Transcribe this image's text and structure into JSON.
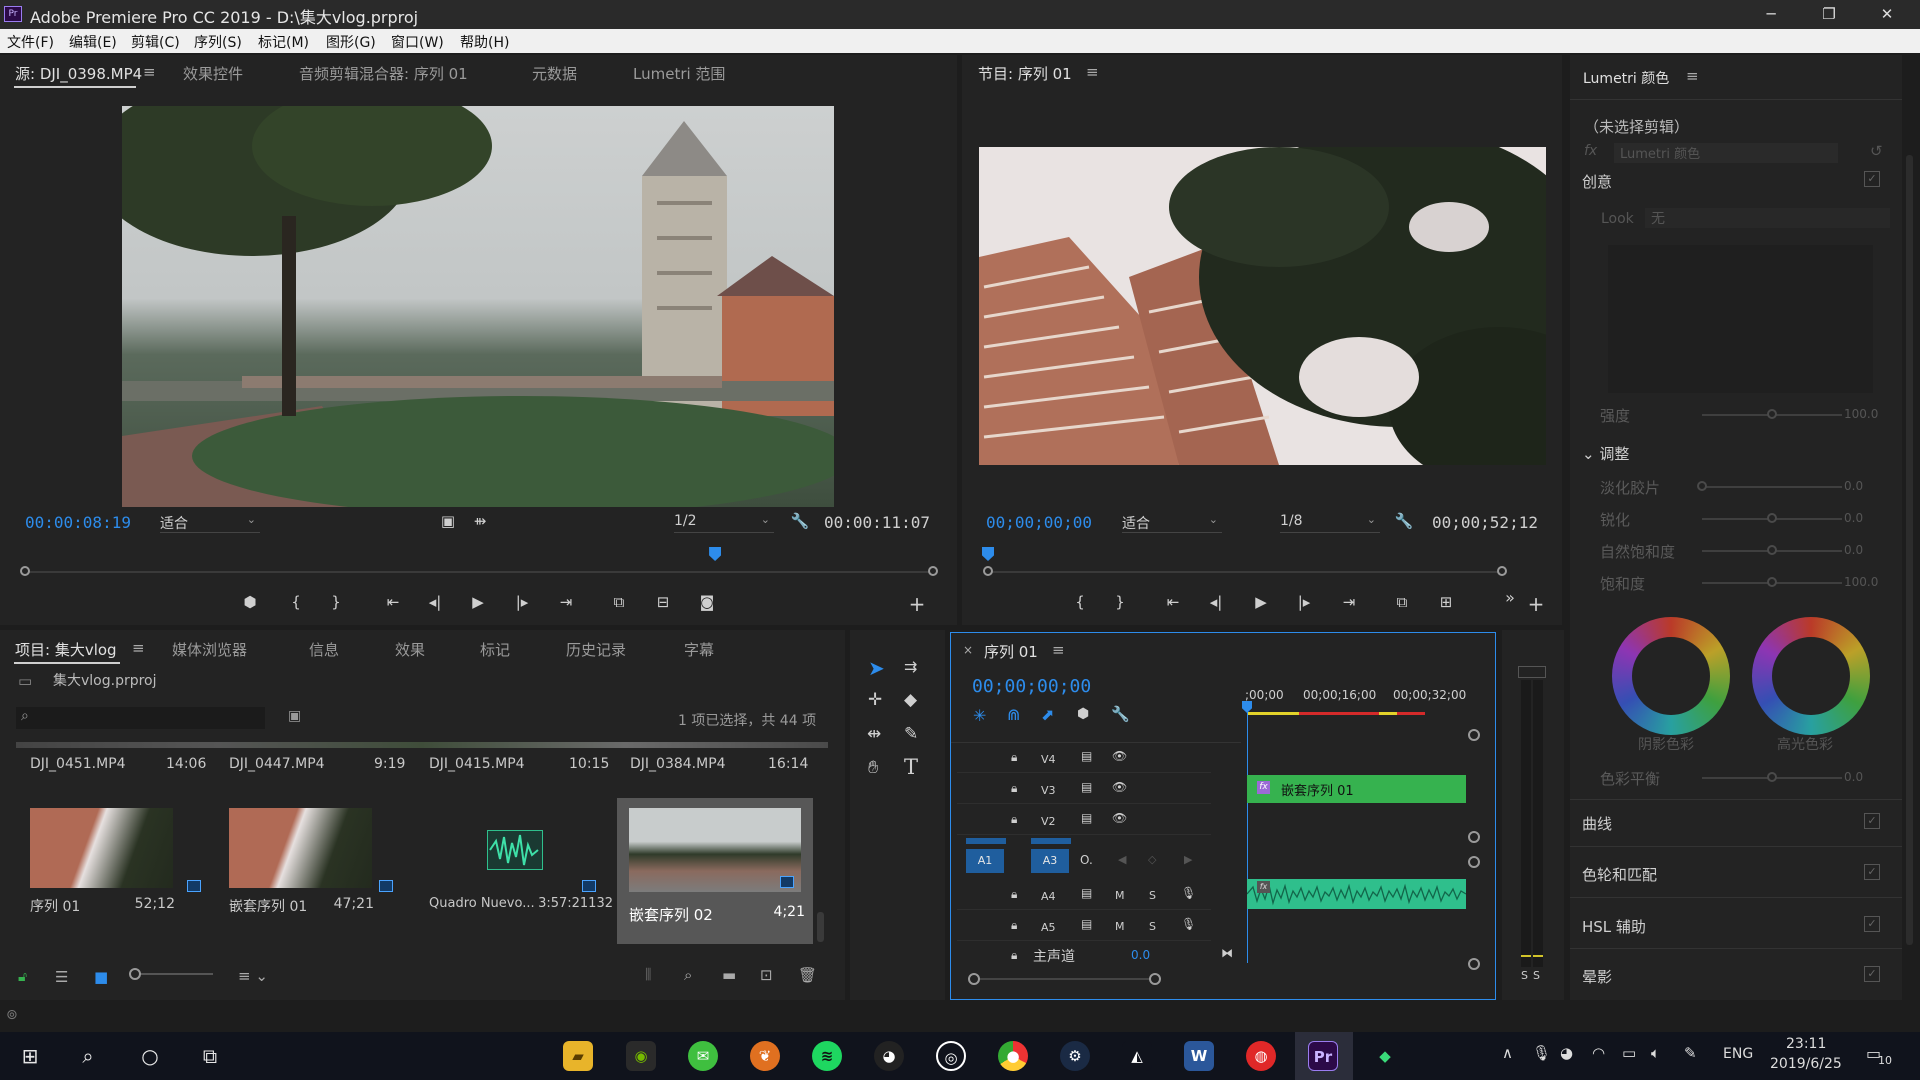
{
  "window": {
    "title": "Adobe Premiere Pro CC 2019 - D:\\集大vlog.prproj",
    "app_logo": "Pr",
    "controls": [
      "─",
      "❐",
      "✕"
    ]
  },
  "menu": [
    "文件(F)",
    "编辑(E)",
    "剪辑(C)",
    "序列(S)",
    "标记(M)",
    "图形(G)",
    "窗口(W)",
    "帮助(H)"
  ],
  "source_panel": {
    "tabs": [
      "源: DJI_0398.MP4",
      "效果控件",
      "音频剪辑混合器: 序列 01",
      "元数据",
      "Lumetri 范围"
    ],
    "timecode": "00:00:08:19",
    "fit": "适合",
    "resolution": "1/2",
    "duration": "00:00:11:07",
    "playhead_fraction": 0.76
  },
  "program_panel": {
    "tab": "节目: 序列 01",
    "timecode": "00;00;00;00",
    "fit": "适合",
    "resolution": "1/8",
    "duration": "00;00;52;12",
    "playhead_fraction": 0.0
  },
  "lumetri": {
    "tab": "Lumetri 颜色",
    "no_clip": "（未选择剪辑）",
    "fx_label": "fx",
    "fx_select": "Lumetri 颜色",
    "creative": "创意",
    "look_label": "Look",
    "look_value": "无",
    "intensity": {
      "label": "强度",
      "value": "100.0",
      "level": 0.5
    },
    "adjust": "调整",
    "adjust_rows": [
      {
        "label": "淡化胶片",
        "value": "0.0",
        "level": 0.0
      },
      {
        "label": "锐化",
        "value": "0.0",
        "level": 0.5
      },
      {
        "label": "自然饱和度",
        "value": "0.0",
        "level": 0.5
      },
      {
        "label": "饱和度",
        "value": "100.0",
        "level": 0.5
      }
    ],
    "wheel_shadow": "阴影色彩",
    "wheel_highlight": "高光色彩",
    "color_balance": {
      "label": "色彩平衡",
      "value": "0.0",
      "level": 0.5
    },
    "sections": [
      "曲线",
      "色轮和匹配",
      "HSL 辅助",
      "晕影"
    ]
  },
  "project_panel": {
    "tabs": [
      "项目: 集大vlog",
      "媒体浏览器",
      "信息",
      "效果",
      "标记",
      "历史记录",
      "字幕"
    ],
    "project_file": "集大vlog.prproj",
    "selection_info": "1 项已选择，共 44 项",
    "top_clips": [
      {
        "name": "DJI_0451.MP4",
        "duration": "14:06"
      },
      {
        "name": "DJI_0447.MP4",
        "duration": "9:19"
      },
      {
        "name": "DJI_0415.MP4",
        "duration": "10:15"
      },
      {
        "name": "DJI_0384.MP4",
        "duration": "16:14"
      }
    ],
    "clips": [
      {
        "name": "序列 01",
        "duration": "52;12"
      },
      {
        "name": "嵌套序列 01",
        "duration": "47;21"
      },
      {
        "name": "Quadro Nuevo...",
        "duration": "3:57:21132"
      },
      {
        "name": "嵌套序列 02",
        "duration": "4;21"
      }
    ]
  },
  "timeline": {
    "tab": "序列 01",
    "timecode": "00;00;00;00",
    "ruler": [
      ";00;00",
      "00;00;16;00",
      "00;00;32;00"
    ],
    "video_tracks": [
      "V4",
      "V3",
      "V2"
    ],
    "audio_tracks": [
      "A3",
      "A4",
      "A5"
    ],
    "source_patch": "A1",
    "mute": "M",
    "solo": "S",
    "master": "主声道",
    "master_value": "0.0",
    "nested_clip": "嵌套序列 01",
    "fx_badge": "fx"
  },
  "meter": {
    "labels": [
      "S",
      "S"
    ]
  },
  "taskbar": {
    "time": "23:11",
    "date": "2019/6/25",
    "lang": "ENG",
    "notifications": "10"
  },
  "colors": {
    "accent_blue": "#2d8ceb",
    "clip_green": "#36b24f",
    "audio_green": "#2fbf8c",
    "panel": "#232323"
  }
}
